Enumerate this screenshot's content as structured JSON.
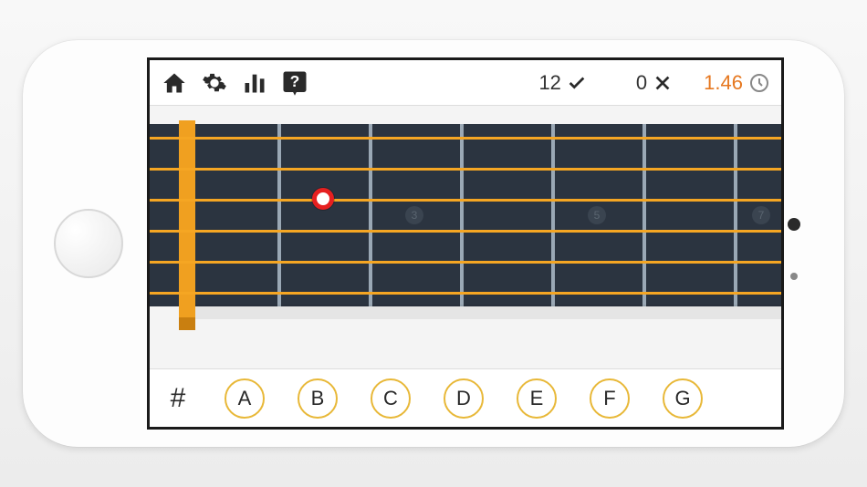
{
  "topbar": {
    "correct_count": "12",
    "wrong_count": "0",
    "timer": "1.46"
  },
  "fretboard": {
    "strings": 6,
    "frets_visible": 7,
    "markers": [
      {
        "fret": 3,
        "label": "3"
      },
      {
        "fret": 5,
        "label": "5"
      },
      {
        "fret": 7,
        "label": "7"
      }
    ],
    "target_note": {
      "string": 3,
      "fret": 2
    }
  },
  "bottombar": {
    "sharp_label": "#",
    "notes": [
      "A",
      "B",
      "C",
      "D",
      "E",
      "F",
      "G"
    ]
  }
}
